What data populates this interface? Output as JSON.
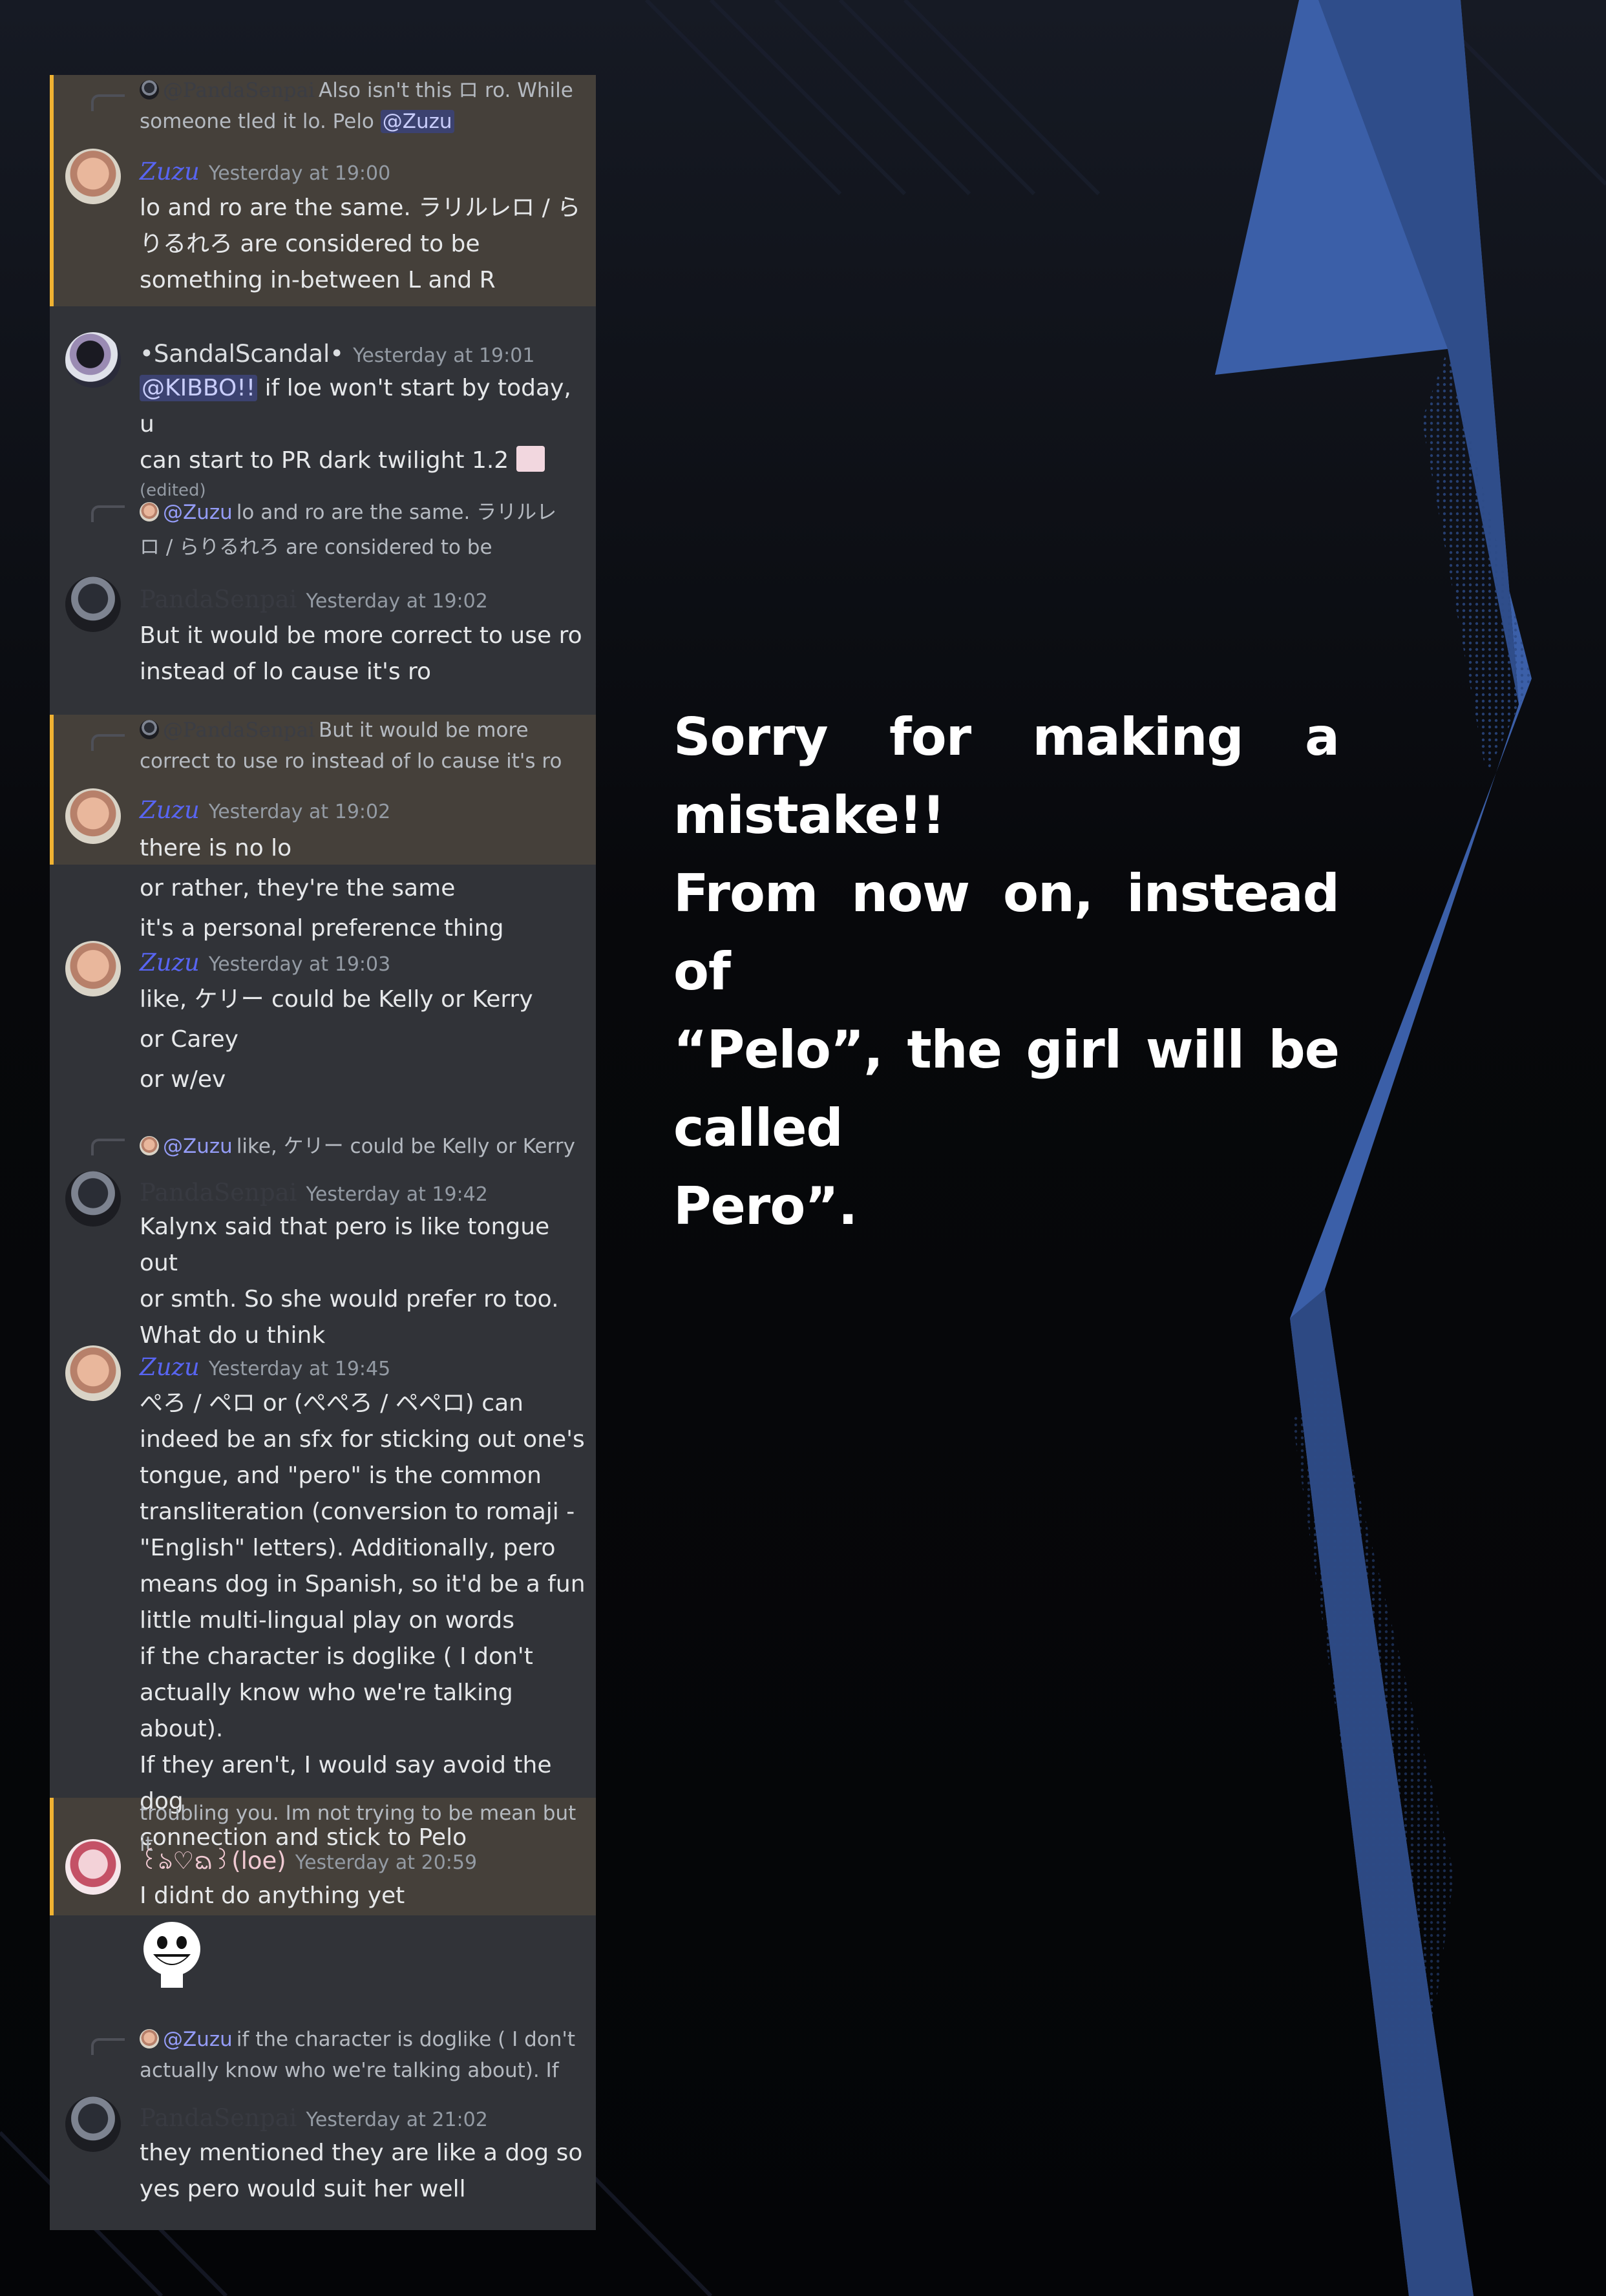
{
  "messages": {
    "m1": {
      "reply_name": "@PandaSenpai",
      "reply_text": "Also isn't this ロ ro. While",
      "reply_text2": "someone tled it lo. Pelo",
      "reply_mention": "@Zuzu",
      "author": "Zuzu",
      "time": "Yesterday at 19:00",
      "lines": [
        "lo and ro are the same. ラリルレロ / ら",
        "りるれろ are considered to be",
        "something in-between L and R"
      ]
    },
    "m2": {
      "author": "•SandalScandal•",
      "time": "Yesterday at 19:01",
      "mention": "@KIBBO!!",
      "line1_rest": "if loe won't start by today, u",
      "line2": "can start to PR dark twilight 1.2",
      "edited": "(edited)"
    },
    "m3": {
      "reply_name": "@Zuzu",
      "reply_text": "lo and ro are the same. ラリルレ",
      "reply_text2": "ロ / らりるれろ are considered to be",
      "author": "PandaSenpai",
      "time": "Yesterday at 19:02",
      "lines": [
        "But it would be more correct to use ro",
        "instead of lo cause it's ro"
      ]
    },
    "m4": {
      "reply_name": "@PandaSenpai",
      "reply_text": "But it would be more",
      "reply_text2": "correct to use ro instead of lo cause it's ro",
      "author": "Zuzu",
      "time": "Yesterday at 19:02",
      "lines": [
        "there is no lo",
        "or rather, they're the same",
        "it's a personal preference thing"
      ]
    },
    "m5": {
      "author": "Zuzu",
      "time": "Yesterday at 19:03",
      "lines": [
        "like, ケリー could be Kelly or Kerry",
        "or Carey",
        "or w/ev"
      ]
    },
    "m6": {
      "reply_name": "@Zuzu",
      "reply_text": "like, ケリー could be Kelly or Kerry",
      "author": "PandaSenpai",
      "time": "Yesterday at 19:42",
      "lines": [
        "Kalynx said that pero is like tongue out",
        "or smth. So she would prefer ro too.",
        "What do u think"
      ]
    },
    "m7": {
      "author": "Zuzu",
      "time": "Yesterday at 19:45",
      "lines": [
        "ぺろ / ペロ or (ぺぺろ / ペペロ) can",
        "indeed be an sfx for sticking out one's",
        "tongue, and \"pero\" is the common",
        "transliteration (conversion to romaji -",
        "\"English\" letters). Additionally, pero",
        "means dog in Spanish, so it'd be a fun",
        "little multi-lingual play on words"
      ],
      "lines2": [
        "if the character is doglike ( I don't",
        "actually know who we're talking about).",
        "If they aren't, I would say avoid the dog",
        "connection and stick to Pelo"
      ]
    },
    "m8": {
      "reply_text": "troubling you. Im not trying to be mean but it",
      "author": "꒰ঌ♡ᨳ꒱(loe)",
      "time": "Yesterday at 20:59",
      "lines": [
        "I didnt do anything yet"
      ]
    },
    "m9": {
      "reply_name": "@Zuzu",
      "reply_text": "if the character is doglike ( I don't",
      "reply_text2": "actually know who we're talking about). If",
      "author": "PandaSenpai",
      "time": "Yesterday at 21:02",
      "lines": [
        "they mentioned they are like a dog so",
        "yes pero would suit her well"
      ]
    }
  },
  "note": {
    "line1": "Sorry for making a mistake!!",
    "line2": "From now on, instead of",
    "line3": "“Pelo”, the girl will be called",
    "line4": "Pero”."
  },
  "colors": {
    "chat_bg": "#313338",
    "highlight_bg": "#45403a",
    "highlight_border": "#f0b232",
    "zuzu_name": "#5865f2",
    "accent_blue": "#3b5fa8"
  }
}
